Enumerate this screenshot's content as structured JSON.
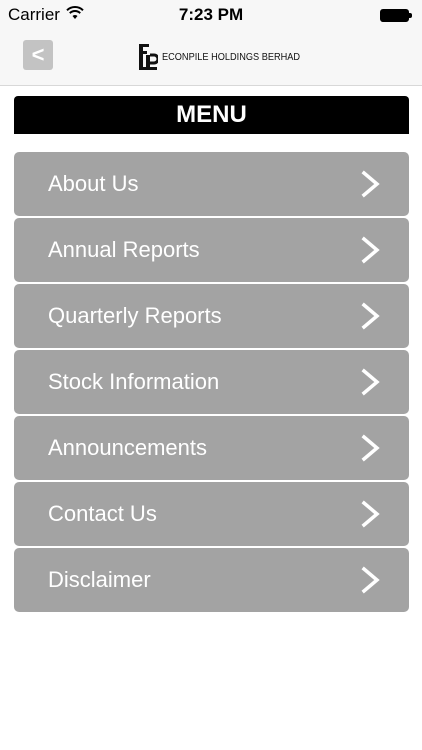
{
  "status_bar": {
    "carrier": "Carrier",
    "time": "7:23 PM",
    "wifi_icon": "wifi-icon",
    "battery_icon": "battery-icon"
  },
  "nav_bar": {
    "back_label": "<",
    "logo_text": "ECONPILE HOLDINGS BERHAD"
  },
  "menu": {
    "title": "MENU",
    "items": [
      {
        "label": "About Us"
      },
      {
        "label": "Annual Reports"
      },
      {
        "label": "Quarterly Reports"
      },
      {
        "label": "Stock Information"
      },
      {
        "label": "Announcements"
      },
      {
        "label": "Contact Us"
      },
      {
        "label": "Disclaimer"
      }
    ]
  },
  "colors": {
    "menu_item_bg": "#a3a3a3",
    "header_bg": "#000000",
    "nav_bg": "#f7f7f7",
    "back_button_bg": "#c3c3c3"
  }
}
